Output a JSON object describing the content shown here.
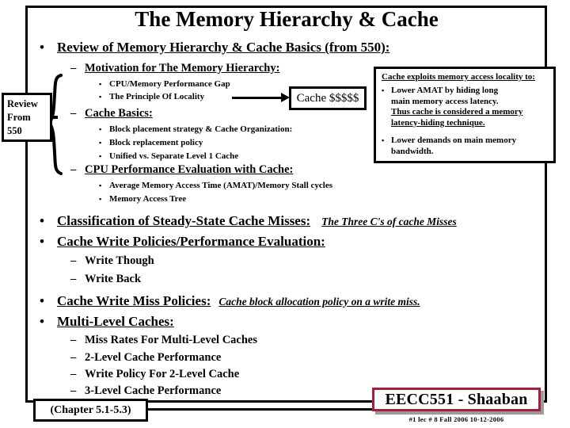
{
  "slide": {
    "title": "The Memory Hierarchy & Cache",
    "footer": {
      "course": "EECC551 - Shaaban",
      "meta": "#1  lec # 8   Fall 2006  10-12-2006",
      "chapter": "(Chapter 5.1-5.3)",
      "accent_color": "#a61f3a"
    },
    "review_badge": {
      "line1": "Review",
      "line2": "From",
      "line3": "550"
    },
    "cache_callout_box": {
      "label": "Cache $$$$$"
    },
    "locality_box": {
      "heading": "Cache exploits memory access locality to:",
      "items": [
        {
          "lines": [
            {
              "text": "Lower AMAT by hiding long",
              "underline": false
            },
            {
              "text": "main memory access latency.",
              "underline": false
            },
            {
              "text": "Thus cache is considered a memory",
              "underline": true
            },
            {
              "text": "latency-hiding technique.",
              "underline": true
            }
          ]
        },
        {
          "lines": [
            {
              "text": "Lower demands on main memory",
              "underline": false
            },
            {
              "text": "bandwidth.",
              "underline": false
            }
          ]
        }
      ]
    },
    "outline": [
      {
        "level": 1,
        "text": "Review of Memory Hierarchy & Cache Basics (from 550):",
        "bullet": "•"
      },
      {
        "level": 2,
        "text": "Motivation for The Memory Hierarchy:",
        "bullet": "–",
        "underline": true
      },
      {
        "level": 3,
        "text": "CPU/Memory Performance Gap",
        "bullet": "▪"
      },
      {
        "level": 3,
        "text": "The Principle Of Locality",
        "bullet": "▪"
      },
      {
        "level": 2,
        "text": "Cache Basics:",
        "bullet": "–",
        "underline": true
      },
      {
        "level": 3,
        "text": "Block placement strategy & Cache Organization:",
        "bullet": "▪"
      },
      {
        "level": 3,
        "text": "Block replacement policy",
        "bullet": "▪"
      },
      {
        "level": 3,
        "text": "Unified vs.  Separate Level 1 Cache",
        "bullet": "▪"
      },
      {
        "level": 2,
        "text": "CPU Performance Evaluation with Cache:",
        "bullet": "–",
        "underline": true
      },
      {
        "level": 3,
        "text": "Average Memory Access Time (AMAT)/Memory Stall cycles",
        "bullet": "▪"
      },
      {
        "level": 3,
        "text": "Memory Access Tree",
        "bullet": "▪"
      },
      {
        "level": 1,
        "text": "Classification of Steady-State Cache Misses:",
        "bullet": "•",
        "note": "The Three C's of cache Misses"
      },
      {
        "level": 1,
        "text": "Cache Write Policies/Performance Evaluation:",
        "bullet": "•"
      },
      {
        "level": 2,
        "text": "Write Though",
        "bullet": "–",
        "underline": false
      },
      {
        "level": 2,
        "text": "Write Back",
        "bullet": "–",
        "underline": false
      },
      {
        "level": 1,
        "text": "Cache Write Miss Policies:",
        "bullet": "•",
        "note": "Cache block allocation policy on a write miss."
      },
      {
        "level": 1,
        "text": "Multi-Level Caches:",
        "bullet": "•"
      },
      {
        "level": 2,
        "text": "Miss Rates For Multi-Level Caches",
        "bullet": "–",
        "underline": false
      },
      {
        "level": 2,
        "text": "2-Level Cache Performance",
        "bullet": "–",
        "underline": false
      },
      {
        "level": 2,
        "text": "Write Policy For 2-Level Cache",
        "bullet": "–",
        "underline": false
      },
      {
        "level": 2,
        "text": "3-Level Cache Performance",
        "bullet": "–",
        "underline": false
      }
    ]
  }
}
